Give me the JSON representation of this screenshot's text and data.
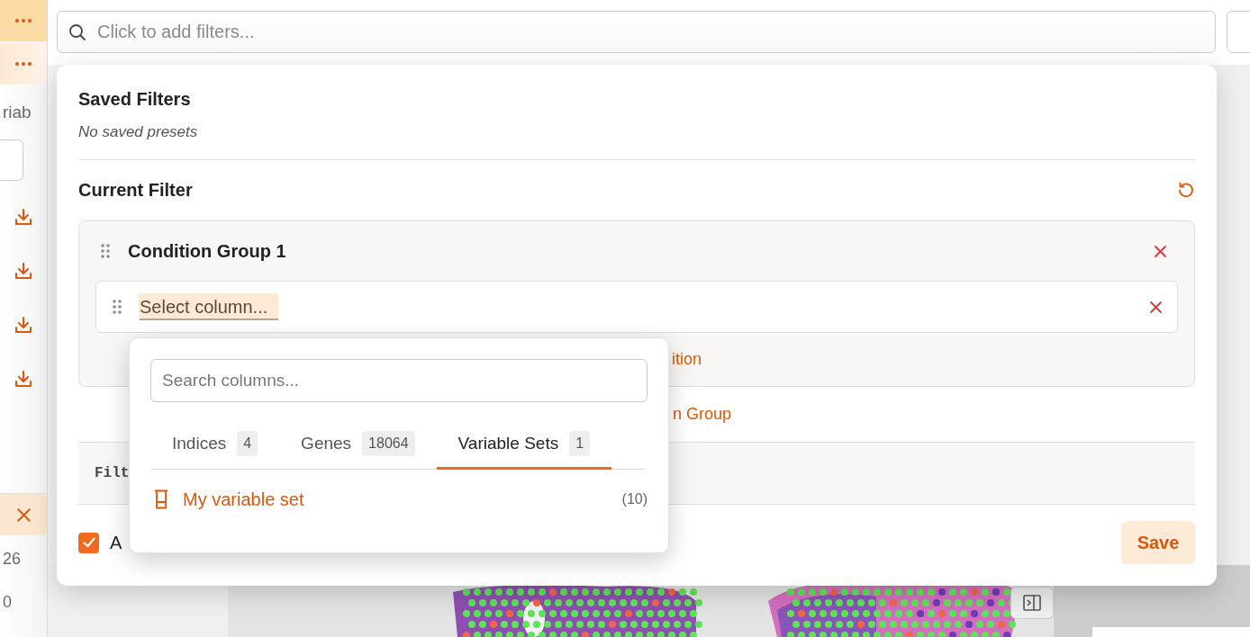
{
  "sidebar": {
    "menu_buttons": [
      {
        "selected": true
      },
      {
        "selected": false
      }
    ],
    "label_fragment": "riab",
    "values": [
      "26",
      "0"
    ]
  },
  "filter_bar": {
    "placeholder": "Click to add filters..."
  },
  "filter_panel": {
    "saved_filters": {
      "title": "Saved Filters",
      "empty_text": "No saved presets"
    },
    "current_filter": {
      "title": "Current Filter",
      "groups": [
        {
          "title": "Condition Group 1",
          "conditions": [
            {
              "column_placeholder": "Select column..."
            }
          ],
          "add_condition_fragment": "ition"
        }
      ],
      "add_group_fragment": "n Group",
      "expression_fragment": "Filt"
    },
    "auto_apply": {
      "checked": true,
      "label_fragment": "A"
    },
    "save_button": "Save"
  },
  "column_picker": {
    "search_placeholder": "Search columns...",
    "tabs": [
      {
        "label": "Indices",
        "count": "4",
        "selected": false
      },
      {
        "label": "Genes",
        "count": "18064",
        "selected": false
      },
      {
        "label": "Variable Sets",
        "count": "1",
        "selected": true
      }
    ],
    "items": [
      {
        "label": "My variable set",
        "count": "(10)"
      }
    ]
  }
}
